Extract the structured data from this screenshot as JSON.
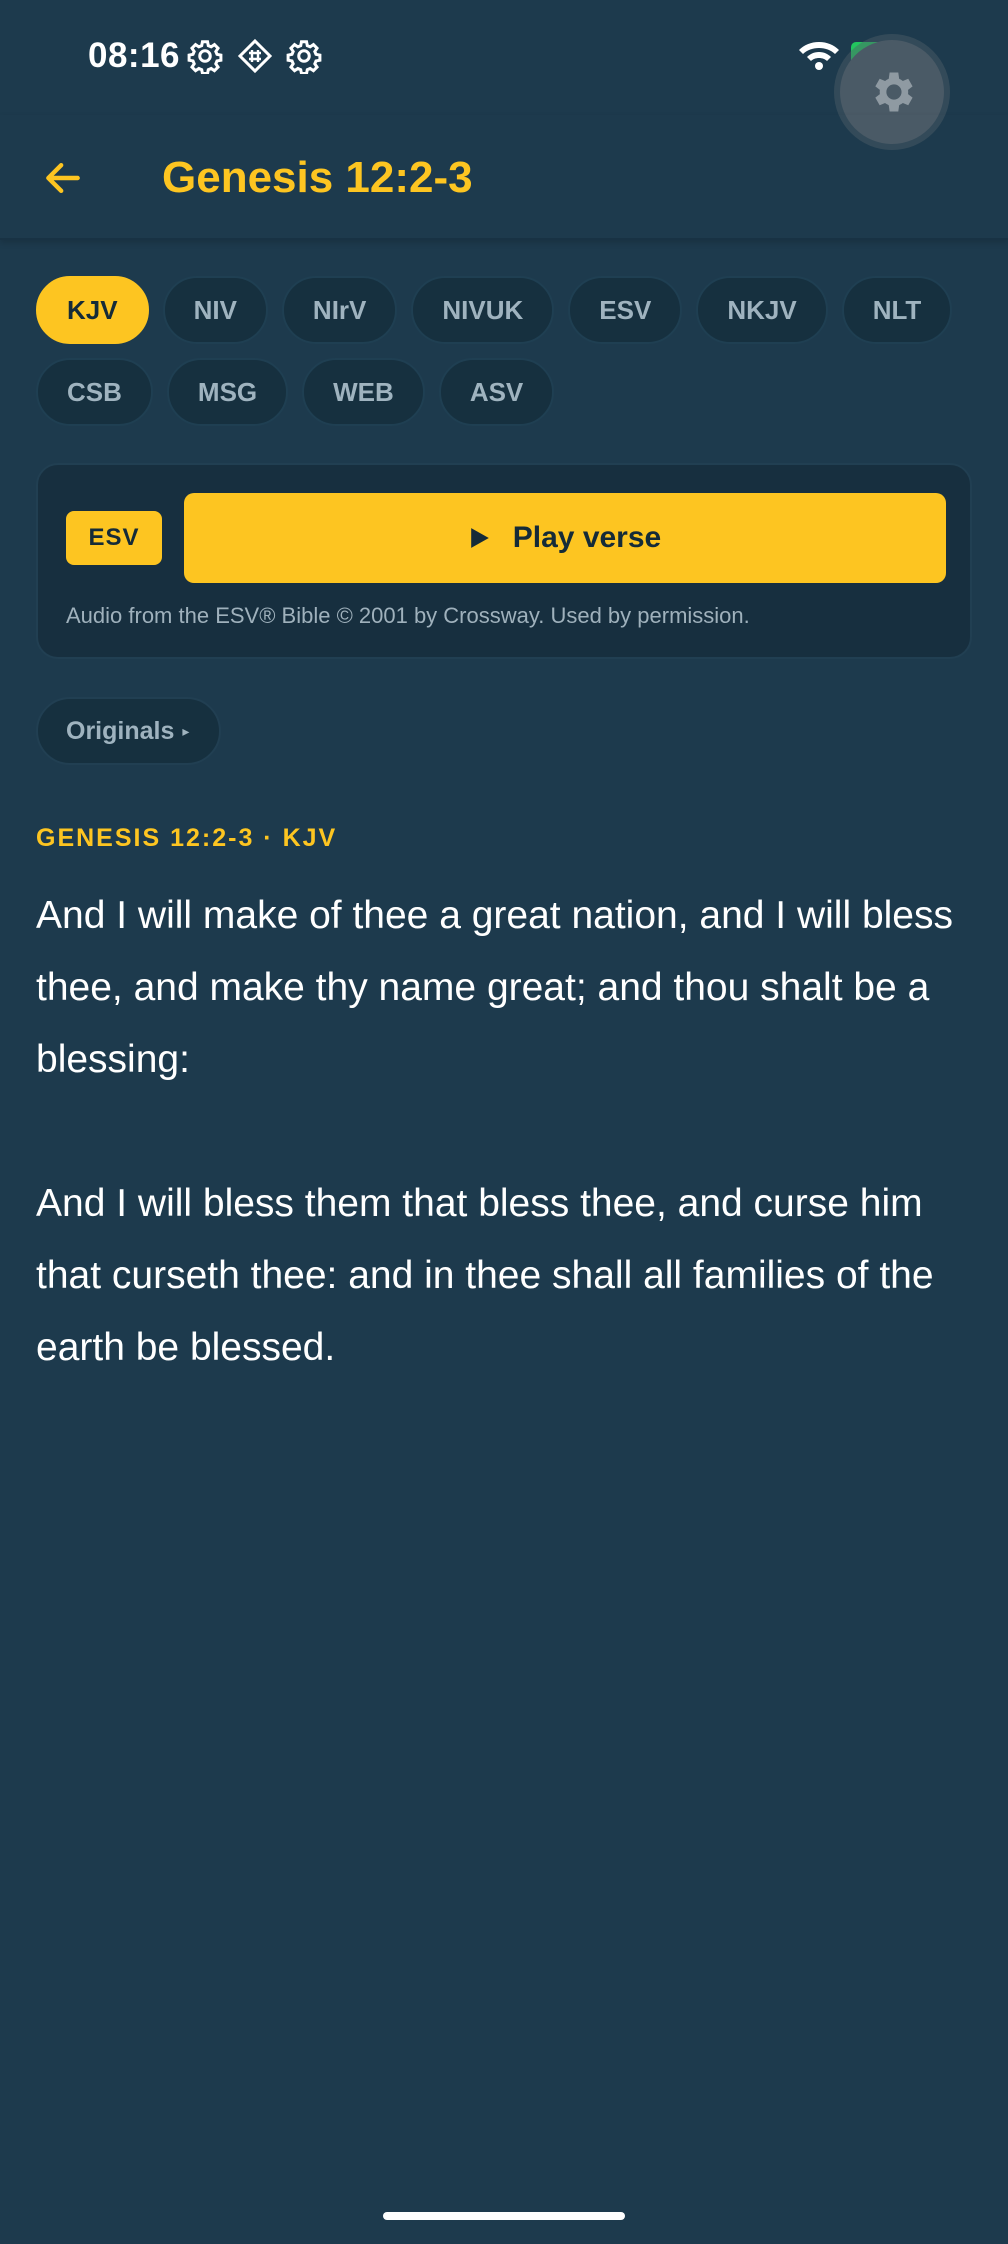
{
  "status_bar": {
    "time": "08:16",
    "icons": [
      "gear-icon",
      "tile-diamond-icon",
      "gear-icon",
      "wifi-icon",
      "battery-charging-icon"
    ]
  },
  "fab": {
    "icon": "gear-icon"
  },
  "app_bar": {
    "back_icon": "arrow-left-icon",
    "title": "Genesis 12:2-3"
  },
  "versions": {
    "active": "KJV",
    "row1": [
      "KJV",
      "NIV",
      "NIrV",
      "NIVUK",
      "ESV",
      "NKJV",
      "NLT"
    ],
    "row2": [
      "CSB",
      "MSG",
      "WEB",
      "ASV"
    ]
  },
  "audio": {
    "badge": "ESV",
    "play_label": "Play verse",
    "credit": "Audio from the ESV® Bible © 2001 by Crossway. Used by permission."
  },
  "originals_label": "Originals",
  "passage": {
    "reference": "GENESIS 12:2-3 · KJV",
    "verses": [
      "And I will make of thee a great nation, and I will bless thee, and make thy name great; and thou shalt be a blessing:",
      "And I will bless them that bless thee, and curse him that curseth thee: and in thee shall all families of the earth be blessed."
    ]
  },
  "colors": {
    "background": "#1d3a4d",
    "accent": "#fdc521",
    "chip_bg": "#16303f",
    "muted_text": "#9fb3bf"
  }
}
